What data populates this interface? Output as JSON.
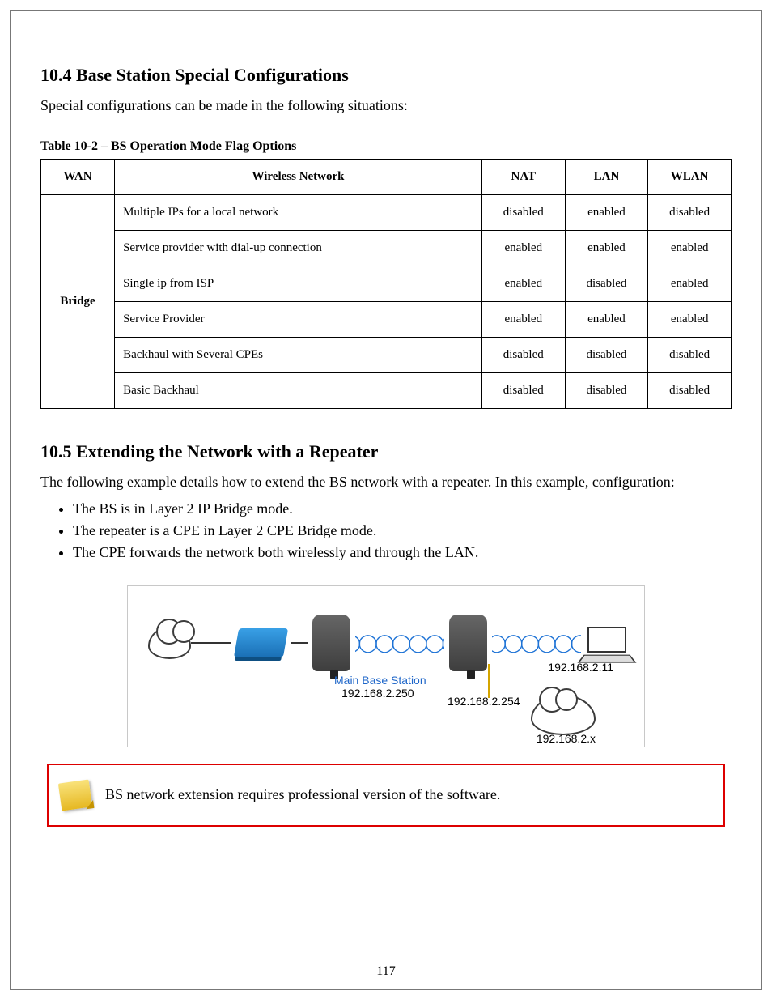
{
  "heading1": "10.4 Base Station Special Configurations",
  "intro": "Special configurations can be made in the following situations:",
  "table_caption": "Table 10-2 – BS Operation Mode Flag Options",
  "table": {
    "headers": [
      "WAN",
      "Wireless Network",
      "NAT",
      "LAN",
      "WLAN"
    ],
    "row_group_header": "Bridge",
    "rows": [
      {
        "scenario": "Multiple IPs for a local network",
        "nat": "disabled",
        "lan": "enabled",
        "wlan": "disabled"
      },
      {
        "scenario": "Service provider with dial-up connection",
        "nat": "enabled",
        "lan": "enabled",
        "wlan": "enabled"
      },
      {
        "scenario": "Single ip from ISP",
        "nat": "enabled",
        "lan": "disabled",
        "wlan": "enabled"
      },
      {
        "scenario": "Service Provider",
        "nat": "enabled",
        "lan": "enabled",
        "wlan": "enabled"
      },
      {
        "scenario": "Backhaul with Several CPEs",
        "nat": "disabled",
        "lan": "disabled",
        "wlan": "disabled"
      },
      {
        "scenario": "Basic Backhaul",
        "nat": "disabled",
        "lan": "disabled",
        "wlan": "disabled"
      }
    ]
  },
  "heading2": "10.5 Extending the Network with a Repeater",
  "para2": "The following example details how to extend the BS network with a repeater. In this example, configuration:",
  "bullets": [
    "The BS is in Layer 2 IP Bridge mode.",
    "The repeater is a CPE in Layer 2 CPE Bridge mode.",
    "The CPE forwards the network both wirelessly and through the LAN."
  ],
  "diagram": {
    "main_label_title": "Main Base Station",
    "main_label_ip": "192.168.2.250",
    "repeater_ip": "192.168.2.254",
    "client_ip": "192.168.2.11",
    "lan_ip": "192.168.2.x"
  },
  "note": "BS network extension requires professional version of the software.",
  "page_number": "117"
}
